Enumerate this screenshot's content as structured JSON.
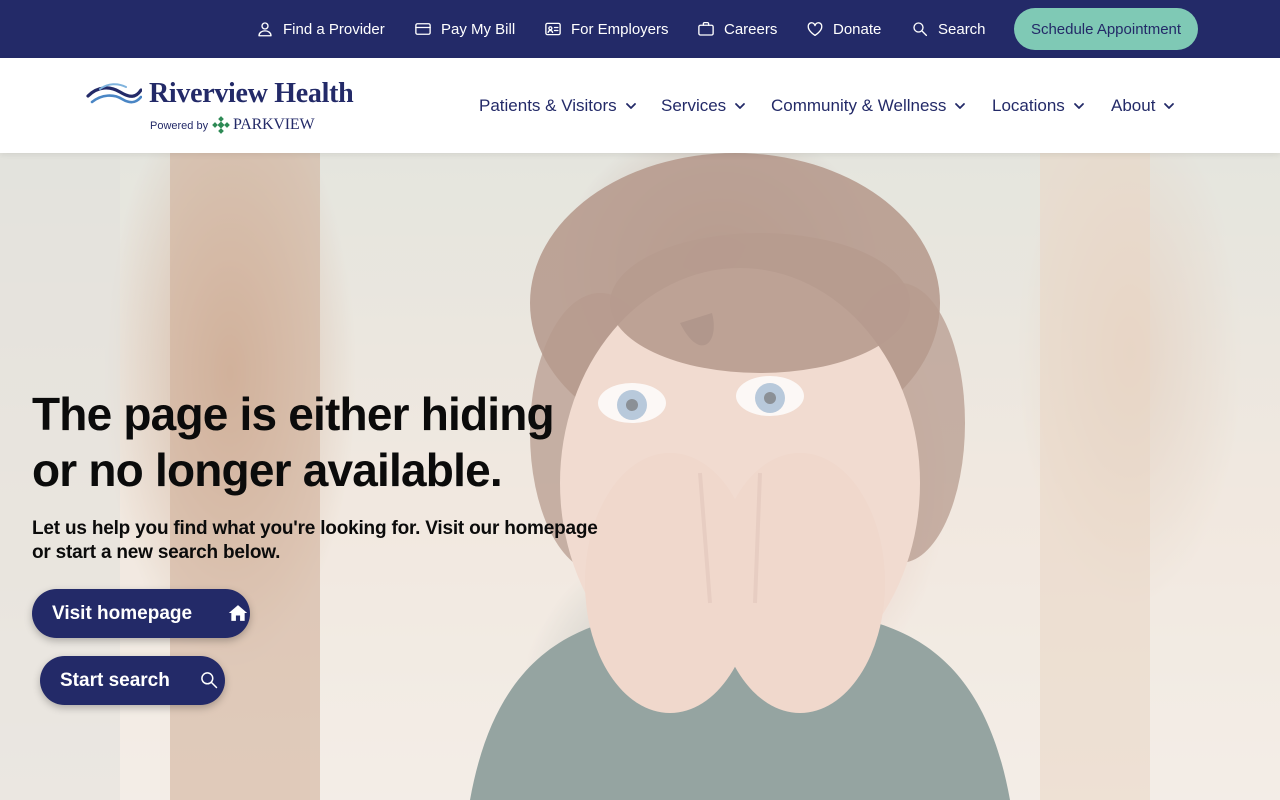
{
  "utility_nav": {
    "items": [
      {
        "label": "Find a Provider",
        "icon": "person-icon"
      },
      {
        "label": "Pay My Bill",
        "icon": "credit-card-icon"
      },
      {
        "label": "For Employers",
        "icon": "id-card-icon"
      },
      {
        "label": "Careers",
        "icon": "briefcase-icon"
      },
      {
        "label": "Donate",
        "icon": "heart-icon"
      },
      {
        "label": "Search",
        "icon": "search-icon"
      }
    ],
    "cta_label": "Schedule Appointment"
  },
  "brand": {
    "name": "Riverview Health",
    "powered_by": "Powered by",
    "partner": "PARKVIEW"
  },
  "main_nav": {
    "items": [
      {
        "label": "Patients & Visitors"
      },
      {
        "label": "Services"
      },
      {
        "label": "Community & Wellness"
      },
      {
        "label": "Locations"
      },
      {
        "label": "About"
      }
    ]
  },
  "hero": {
    "title_line1": "The page is either hiding",
    "title_line2": "or no longer available.",
    "subtitle_line1": "Let us help you find what you're looking for. Visit our homepage",
    "subtitle_line2": "or start a new search below.",
    "homepage_button": "Visit homepage",
    "search_button": "Start search"
  },
  "colors": {
    "navy": "#232a68",
    "teal": "#7fc9b5",
    "partner_green": "#2e8a55"
  }
}
